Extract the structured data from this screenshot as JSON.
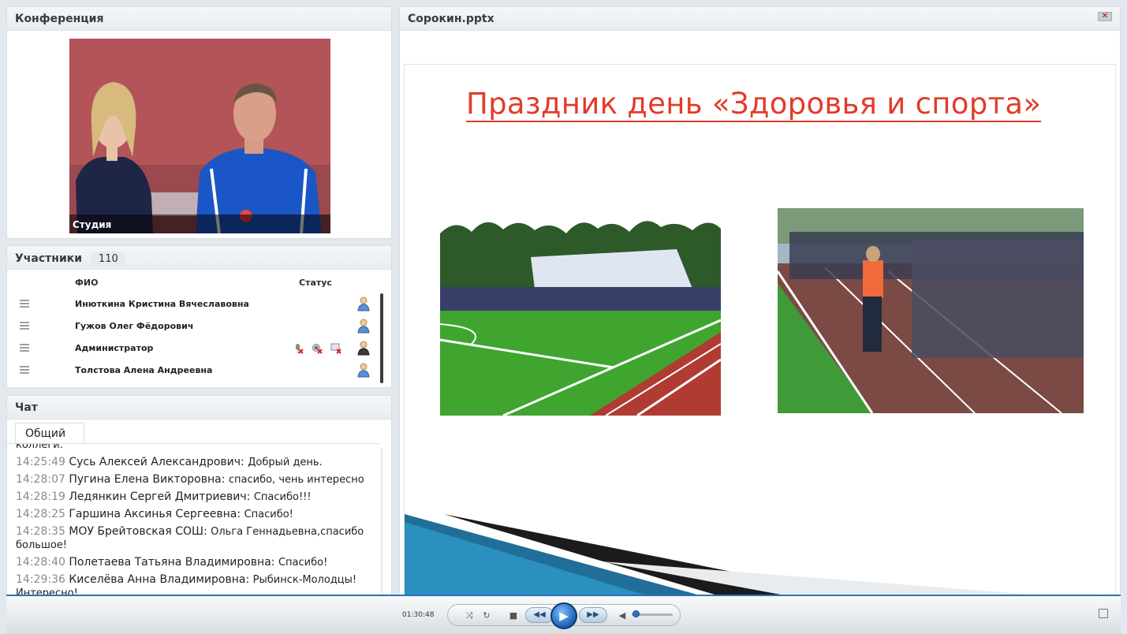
{
  "conference": {
    "title": "Конференция",
    "video_label": "Студия"
  },
  "participants": {
    "title": "Участники",
    "count": "110",
    "col_name": "ФИО",
    "col_status": "Статус",
    "rows": [
      {
        "name": "Инюткина  Кристина Вячеславовна"
      },
      {
        "name": "Гужов Олег  Фёдорович"
      },
      {
        "name": "Администратор"
      },
      {
        "name": "Толстова Алена  Андреевна"
      }
    ]
  },
  "chat": {
    "title": "Чат",
    "tab_label": "Общий",
    "cut_line": "коллеги.",
    "messages": [
      {
        "time": "14:25:49",
        "author": "Сусь Алексей  Александрович:",
        "text": "Добрый день."
      },
      {
        "time": "14:28:07",
        "author": "Пугина Елена   Викторовна:",
        "text": "спасибо, чень интересно"
      },
      {
        "time": "14:28:19",
        "author": "Ледянкин Сергей  Дмитриевич:",
        "text": "Спасибо!!!"
      },
      {
        "time": "14:28:25",
        "author": "Гаршина  Аксинья   Сергеевна:",
        "text": "Спасибо!"
      },
      {
        "time": "14:28:35",
        "author": "МОУ Брейтовская СОШ:",
        "text": "Ольга Геннадьевна,спасибо большое!"
      },
      {
        "time": "14:28:40",
        "author": "Полетаева Татьяна  Владимировна:",
        "text": "Спасибо!"
      },
      {
        "time": "14:29:36",
        "author": "Киселёва Анна  Владимировна:",
        "text": "Рыбинск-Молодцы! Интересно!"
      }
    ]
  },
  "presentation": {
    "filename": "Сорокин.pptx",
    "slide_title": "Праздник  день «Здоровья и спорта»"
  },
  "player": {
    "time": "01:30:48",
    "volume_fraction": 0.1
  },
  "colors": {
    "accent": "#2f6fbd",
    "title_red": "#e23b2b"
  }
}
